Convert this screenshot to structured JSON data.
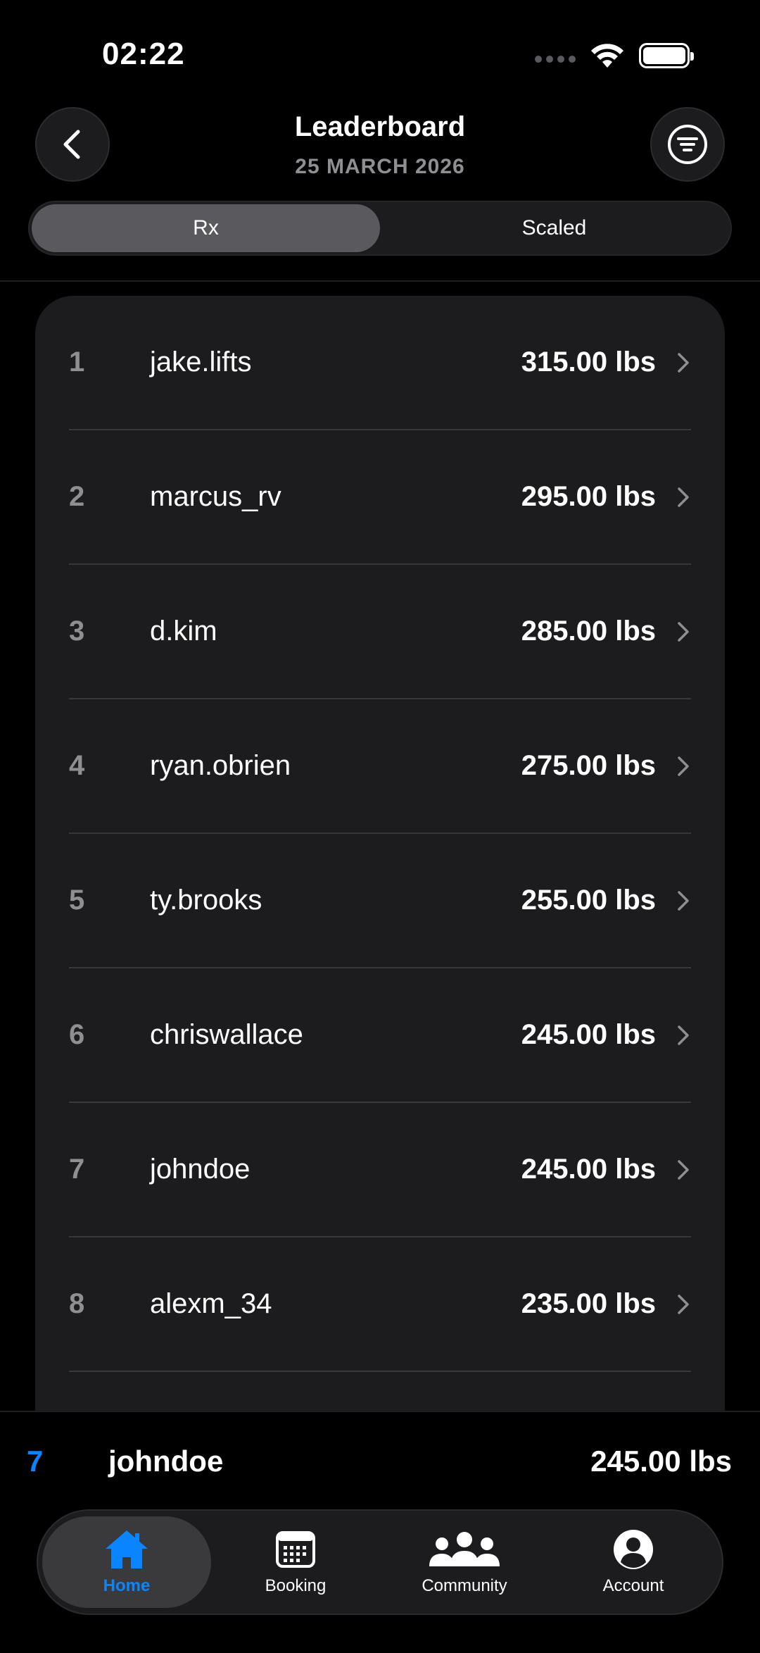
{
  "status_bar": {
    "time": "02:22"
  },
  "header": {
    "title": "Leaderboard",
    "date": "25 MARCH 2026",
    "back_icon": "chevron-left-icon",
    "filter_icon": "filter-icon"
  },
  "segments": [
    {
      "label": "Rx",
      "active": true
    },
    {
      "label": "Scaled",
      "active": false
    }
  ],
  "leaderboard": [
    {
      "rank": "1",
      "name": "jake.lifts",
      "score": "315.00 lbs"
    },
    {
      "rank": "2",
      "name": "marcus_rv",
      "score": "295.00 lbs"
    },
    {
      "rank": "3",
      "name": "d.kim",
      "score": "285.00 lbs"
    },
    {
      "rank": "4",
      "name": "ryan.obrien",
      "score": "275.00 lbs"
    },
    {
      "rank": "5",
      "name": "ty.brooks",
      "score": "255.00 lbs"
    },
    {
      "rank": "6",
      "name": "chriswallace",
      "score": "245.00 lbs"
    },
    {
      "rank": "7",
      "name": "johndoe",
      "score": "245.00 lbs"
    },
    {
      "rank": "8",
      "name": "alexm_34",
      "score": "235.00 lbs"
    }
  ],
  "current_user": {
    "rank": "7",
    "name": "johndoe",
    "score": "245.00 lbs"
  },
  "tabs": [
    {
      "label": "Home",
      "icon": "home-icon",
      "active": true
    },
    {
      "label": "Booking",
      "icon": "calendar-icon",
      "active": false
    },
    {
      "label": "Community",
      "icon": "community-icon",
      "active": false
    },
    {
      "label": "Account",
      "icon": "account-icon",
      "active": false
    }
  ],
  "colors": {
    "accent": "#0a84ff",
    "background": "#000000",
    "card": "#1c1c1e",
    "muted": "#8e8e93"
  }
}
